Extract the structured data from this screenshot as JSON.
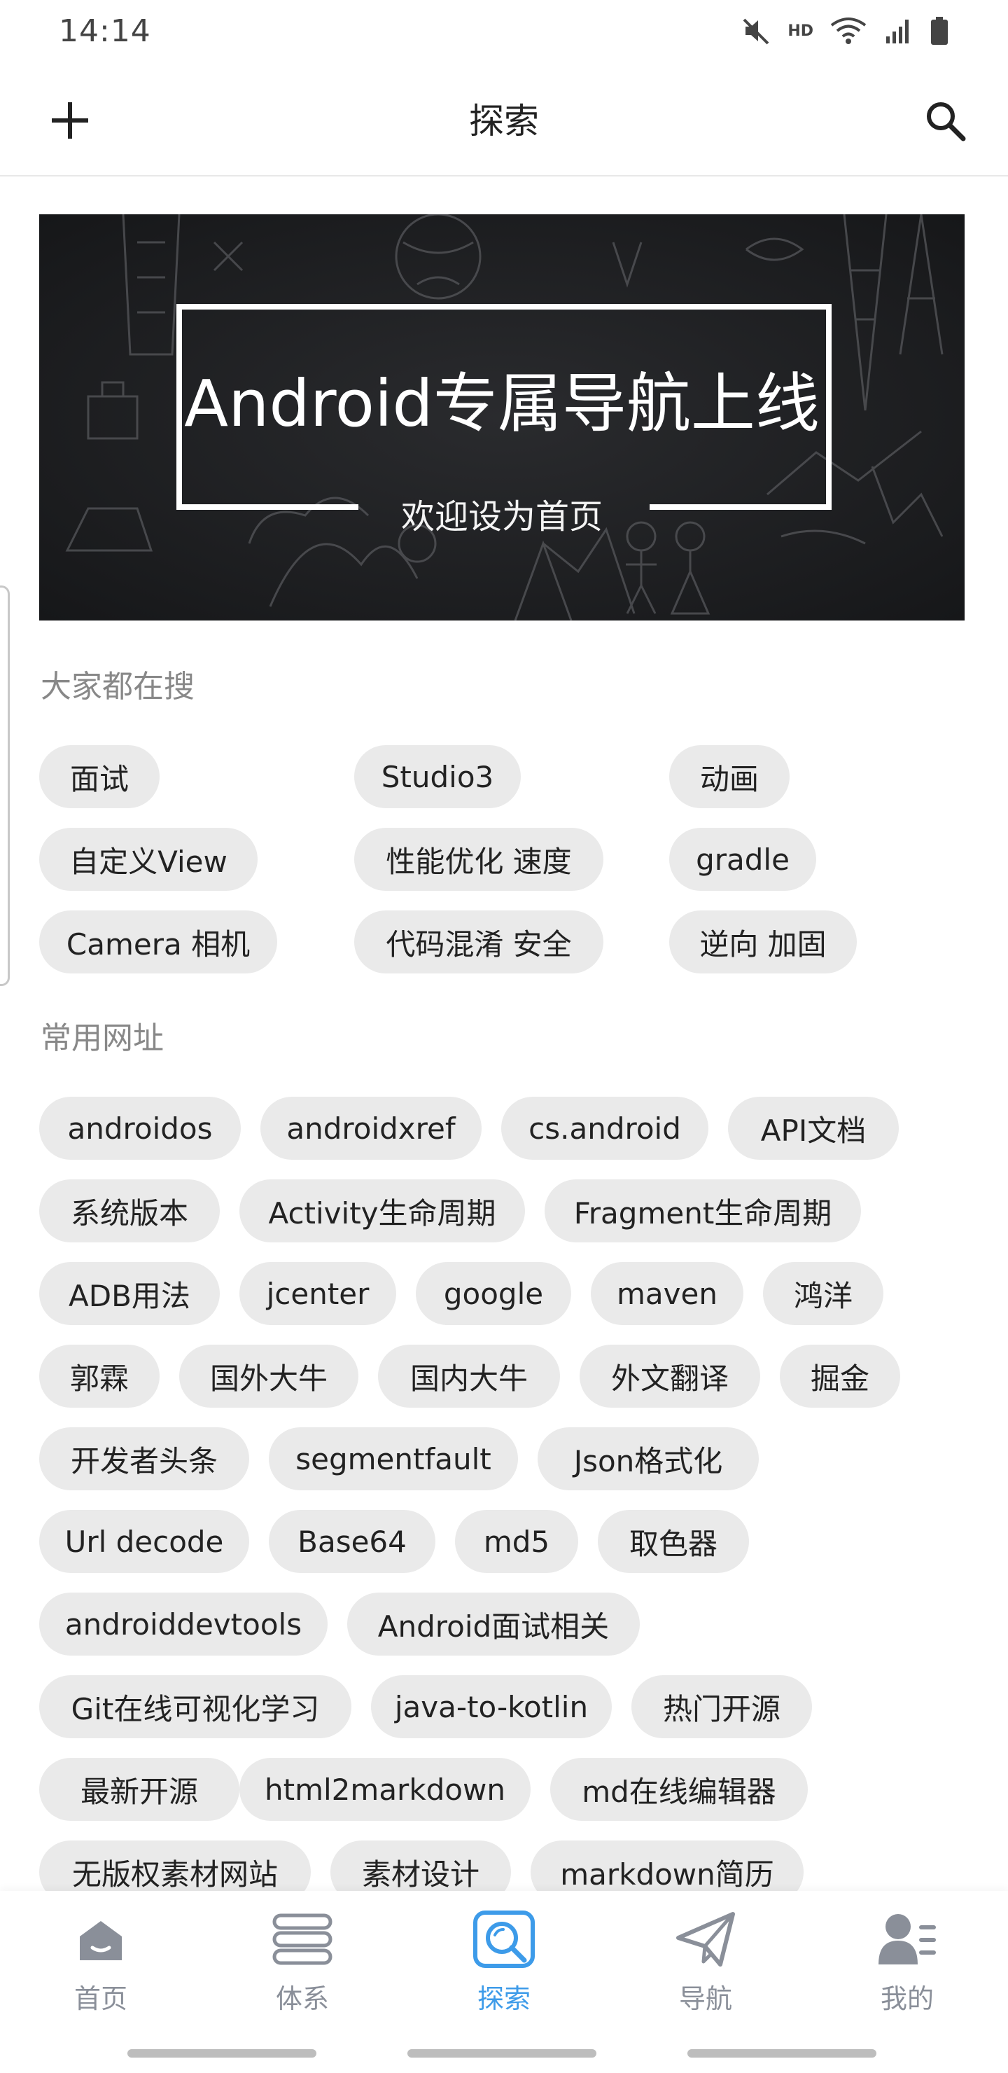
{
  "status_bar": {
    "time": "14:14",
    "hd_label": "HD",
    "icons": [
      "mute-icon",
      "wifi-icon",
      "signal-icon",
      "battery-icon"
    ]
  },
  "app_bar": {
    "title": "探索",
    "left_icon": "add-icon",
    "right_icon": "search-icon"
  },
  "banner": {
    "title": "Android专属导航上线",
    "subtitle": "欢迎设为首页"
  },
  "hot_searches": {
    "title": "大家都在搜",
    "items": [
      "面试",
      "Studio3",
      "动画",
      "自定义View",
      "性能优化 速度",
      "gradle",
      "Camera 相机",
      "代码混淆 安全",
      "逆向 加固"
    ]
  },
  "common_sites": {
    "title": "常用网址",
    "items": [
      "androidos",
      "androidxref",
      "cs.android",
      "API文档",
      "系统版本",
      "Activity生命周期",
      "Fragment生命周期",
      "ADB用法",
      "jcenter",
      "google",
      "maven",
      "鸿洋",
      "郭霖",
      "国外大牛",
      "国内大牛",
      "外文翻译",
      "掘金",
      "开发者头条",
      "segmentfault",
      "Json格式化",
      "Url decode",
      "Base64",
      "md5",
      "取色器",
      "androiddevtools",
      "Android面试相关",
      "Git在线可视化学习",
      "java-to-kotlin",
      "热门开源",
      "最新开源",
      "html2markdown",
      "md在线编辑器",
      "无版权素材网站",
      "素材设计",
      "markdown简历"
    ]
  },
  "bottom_nav": {
    "active_index": 2,
    "active_color": "#3d9be9",
    "inactive_color": "#8a8f99",
    "items": [
      {
        "label": "首页",
        "icon": "home-icon"
      },
      {
        "label": "体系",
        "icon": "layers-icon"
      },
      {
        "label": "探索",
        "icon": "explore-icon"
      },
      {
        "label": "导航",
        "icon": "paper-plane-icon"
      },
      {
        "label": "我的",
        "icon": "profile-icon"
      }
    ]
  }
}
